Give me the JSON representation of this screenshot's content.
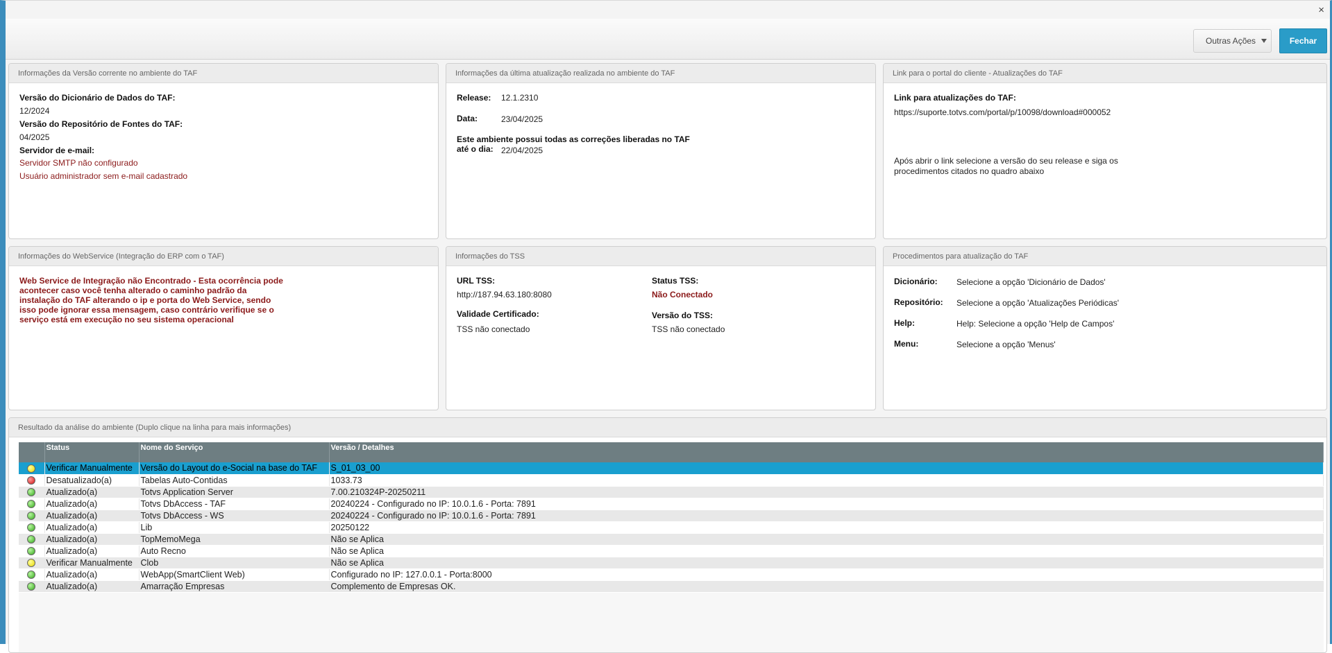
{
  "toolbar": {
    "close_symbol": "×",
    "outras_acoes": "Outras Ações",
    "fechar": "Fechar"
  },
  "versao_panel": {
    "title": "Informações da Versão corrente no ambiente do TAF",
    "dic_label": "Versão do Dicionário de Dados do TAF:",
    "dic_value": "12/2024",
    "repo_label": "Versão do Repositório de Fontes do TAF:",
    "repo_value": "04/2025",
    "email_label": "Servidor de e-mail:",
    "smtp_msg": "Servidor SMTP não configurado",
    "admin_msg": "Usuário administrador sem e-mail cadastrado"
  },
  "atualizacao_panel": {
    "title": "Informações da última atualização realizada no ambiente do TAF",
    "release_label": "Release:",
    "release_value": "12.1.2310",
    "data_label": "Data:",
    "data_value": "23/04/2025",
    "correcoes_label_1": "Este ambiente possui todas as correções liberadas no TAF",
    "correcoes_label_2": "até o dia:",
    "correcoes_value": "22/04/2025"
  },
  "link_panel": {
    "title": "Link para o portal do cliente - Atualizações do TAF",
    "link_label": "Link para atualizações do TAF:",
    "link_url": "https://suporte.totvs.com/portal/p/10098/download#000052",
    "instr_1": "Após abrir o link selecione a versão do seu release e siga os",
    "instr_2": "procedimentos citados no quadro abaixo"
  },
  "ws_panel": {
    "title": "Informações do WebService (Integração do ERP com o TAF)",
    "line_1": "Web Service de Integração não Encontrado - Esta ocorrência pode",
    "line_2": "acontecer caso você tenha alterado o caminho padrão da",
    "line_3": "instalação do TAF alterando o ip e porta do Web Service, sendo",
    "line_4": "isso pode ignorar essa mensagem, caso contrário verifique se o",
    "line_5": "serviço está em execução no seu sistema operacional"
  },
  "tss_panel": {
    "title": "Informações do TSS",
    "url_label": "URL TSS:",
    "url_value": "http://187.94.63.180:8080",
    "status_label": "Status TSS:",
    "status_value": "Não Conectado",
    "cert_label": "Validade Certificado:",
    "cert_value": "TSS não conectado",
    "versao_label": "Versão do TSS:",
    "versao_value": "TSS não conectado"
  },
  "proc_panel": {
    "title": "Procedimentos para atualização do TAF",
    "items": [
      {
        "label": "Dicionário:",
        "text": "Selecione a opção 'Dicionário de Dados'"
      },
      {
        "label": "Repositório:",
        "text": "Selecione a opção 'Atualizações Periódicas'"
      },
      {
        "label": "Help:",
        "text": "Help: Selecione a opção 'Help de Campos'"
      },
      {
        "label": "Menu:",
        "text": "Selecione a opção 'Menus'"
      }
    ]
  },
  "result_panel": {
    "title": "Resultado da análise do ambiente (Duplo clique na linha para mais informações)",
    "columns": [
      "Status",
      "Nome do Serviço",
      "Versão / Detalhes"
    ],
    "rows": [
      {
        "indicator": "yellow",
        "status": "Verificar Manualmente",
        "service": "Versão do Layout do e-Social na base do TAF",
        "details": "S_01_03_00"
      },
      {
        "indicator": "red",
        "status": "Desatualizado(a)",
        "service": "Tabelas Auto-Contidas",
        "details": "1033.73"
      },
      {
        "indicator": "green",
        "status": "Atualizado(a)",
        "service": "Totvs Application Server",
        "details": "7.00.210324P-20250211"
      },
      {
        "indicator": "green",
        "status": "Atualizado(a)",
        "service": "Totvs DbAccess - TAF",
        "details": "20240224 - Configurado no IP: 10.0.1.6 - Porta: 7891"
      },
      {
        "indicator": "green",
        "status": "Atualizado(a)",
        "service": "Totvs DbAccess - WS",
        "details": "20240224 - Configurado no IP: 10.0.1.6 - Porta: 7891"
      },
      {
        "indicator": "green",
        "status": "Atualizado(a)",
        "service": "Lib",
        "details": "20250122"
      },
      {
        "indicator": "green",
        "status": "Atualizado(a)",
        "service": "TopMemoMega",
        "details": "Não se Aplica"
      },
      {
        "indicator": "green",
        "status": "Atualizado(a)",
        "service": "Auto Recno",
        "details": "Não se Aplica"
      },
      {
        "indicator": "yellow",
        "status": "Verificar Manualmente",
        "service": "Clob",
        "details": "Não se Aplica"
      },
      {
        "indicator": "green",
        "status": "Atualizado(a)",
        "service": "WebApp(SmartClient Web)",
        "details": "Configurado no IP: 127.0.0.1 - Porta:8000"
      },
      {
        "indicator": "green",
        "status": "Atualizado(a)",
        "service": "Amarração Empresas",
        "details": "Complemento de Empresas OK."
      }
    ]
  },
  "colors": {
    "accent": "#2a9cc8",
    "selected_row": "#1a9fcf",
    "header_gray": "#6e7e82",
    "error_red": "#8b1a1a"
  }
}
